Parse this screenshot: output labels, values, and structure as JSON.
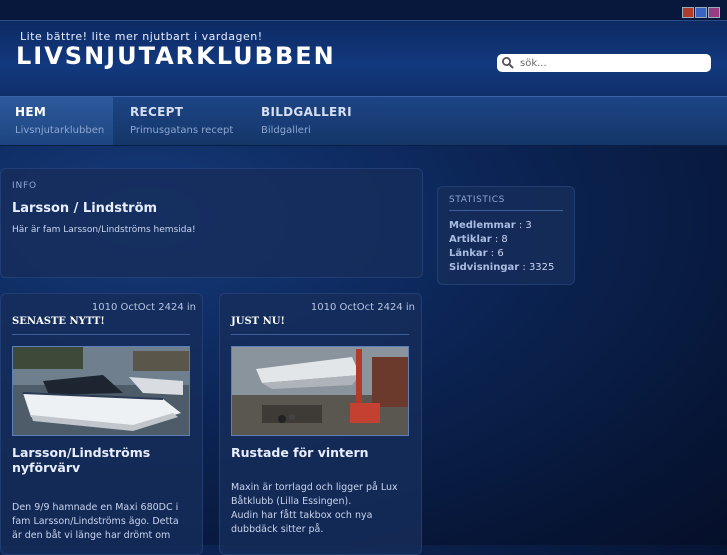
{
  "colors": {
    "swatch_red": "#b23a2a",
    "swatch_blue": "#3a63c4",
    "swatch_purple": "#9a3b86"
  },
  "header": {
    "tagline": "Lite bättre! lite mer njutbart i vardagen!",
    "title": "LIVSNJUTARKLUBBEN"
  },
  "search": {
    "placeholder": "sök..."
  },
  "nav": [
    {
      "label": "HEM",
      "sub": "Livsnjutarklubben"
    },
    {
      "label": "RECEPT",
      "sub": "Primusgatans recept"
    },
    {
      "label": "BILDGALLERI",
      "sub": "Bildgalleri"
    }
  ],
  "info": {
    "label": "INFO",
    "title": "Larsson / Lindström",
    "text": "Här är fam Larsson/Lindströms hemsida!"
  },
  "stats": {
    "label": "STATISTICS",
    "rows": [
      {
        "name": "Medlemmar",
        "value": ": 3"
      },
      {
        "name": "Artiklar",
        "value": ": 8"
      },
      {
        "name": "Länkar",
        "value": ": 6"
      },
      {
        "name": "Sidvisningar",
        "value": ": 3325"
      }
    ]
  },
  "posts": [
    {
      "date": "1010 OctOct 2424 in",
      "heading": "SENASTE NYTT!",
      "title_line1": "Larsson/Lindströms",
      "title_line2": "nyförvärv",
      "body": [
        "Den 9/9 hamnade en Maxi 680DC i",
        "fam Larsson/Lindströms ägo. Detta",
        "är den båt vi länge har drömt om"
      ]
    },
    {
      "date": "1010 OctOct 2424 in",
      "heading": "JUST NU!",
      "title_line1": "Rustade för vintern",
      "body": [
        "Maxin är torrlagd och ligger på Lux",
        "Båtklubb (Lilla Essingen).",
        "Audin har fått takbox och nya",
        "dubbdäck sitter på."
      ]
    }
  ]
}
